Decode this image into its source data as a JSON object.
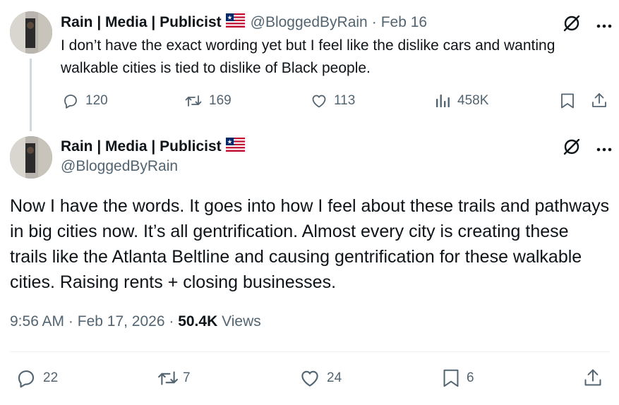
{
  "reply_tweet": {
    "display_name": "Rain | Media | Publicist",
    "handle": "@BloggedByRain",
    "separator": "·",
    "date": "Feb 16",
    "text": "I don’t have the exact wording yet but I feel like the dislike cars and wanting walkable cities is tied to dislike of Black people.",
    "stats": {
      "replies": "120",
      "reposts": "169",
      "likes": "113",
      "views": "458K"
    }
  },
  "main_tweet": {
    "display_name": "Rain | Media | Publicist",
    "handle": "@BloggedByRain",
    "text": "Now I have the words. It goes into how I feel about these trails and pathways in big cities now. It’s all gentrification. Almost every city is creating these trails like the Atlanta Beltline and causing gentrification for these walkable cities. Raising rents + closing businesses.",
    "time": "9:56 AM",
    "sep1": "·",
    "date": "Feb 17, 2026",
    "sep2": "·",
    "views_count": "50.4K",
    "views_label": "Views",
    "stats": {
      "replies": "22",
      "reposts": "7",
      "likes": "24",
      "bookmarks": "6"
    }
  },
  "colors": {
    "text": "#0f1419",
    "secondary": "#536471",
    "thread_line": "#cfd9de",
    "flag_red": "#bf0a30",
    "flag_blue": "#002868"
  },
  "icons": [
    "avatar",
    "liberia-flag-icon",
    "grok-icon",
    "more-icon",
    "reply-icon",
    "repost-icon",
    "like-icon",
    "views-icon",
    "bookmark-icon",
    "share-icon"
  ]
}
